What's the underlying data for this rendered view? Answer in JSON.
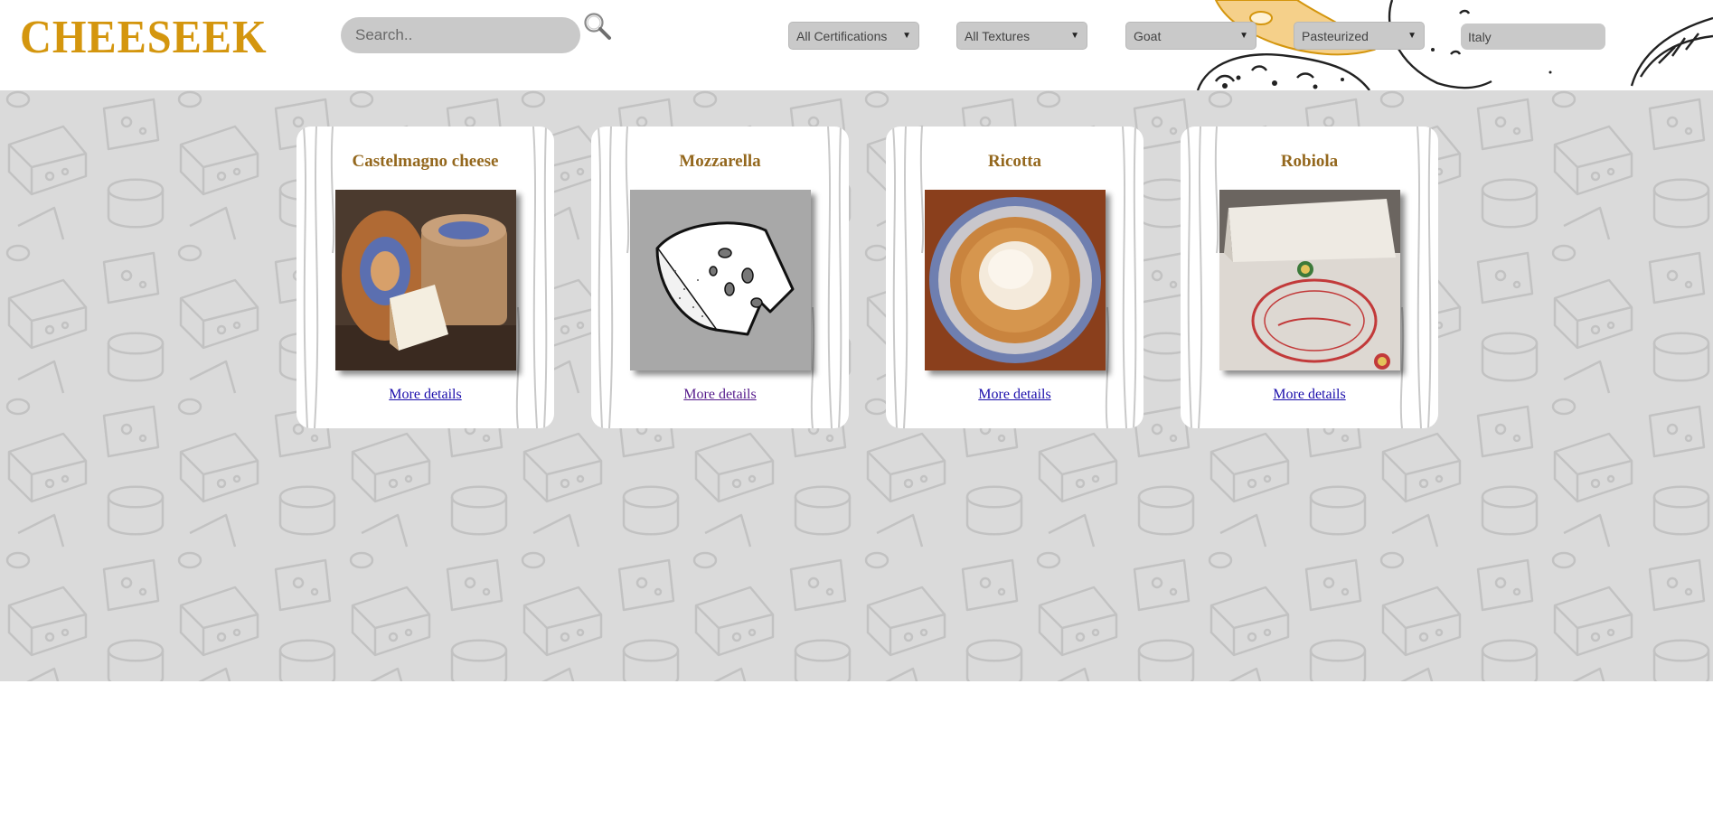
{
  "header": {
    "logo": "CHEESEEK",
    "search": {
      "placeholder": "Search..",
      "value": ""
    },
    "filters": {
      "certification": "All Certifications",
      "texture": "All Textures",
      "milk": "Goat",
      "treatment": "Pasteurized"
    },
    "country": {
      "value": "Italy"
    }
  },
  "cards": [
    {
      "title": "Castelmagno cheese",
      "link": "More details"
    },
    {
      "title": "Mozzarella",
      "link": "More details"
    },
    {
      "title": "Ricotta",
      "link": "More details"
    },
    {
      "title": "Robiola",
      "link": "More details"
    }
  ],
  "colors": {
    "logo": "#d4960e",
    "card_title": "#94681e",
    "link": "#1a0dab",
    "link_visited": "#551a8b",
    "background": "#dadada",
    "control": "#c9c9c9"
  },
  "icons": [
    "search-icon",
    "chevron-down-icon"
  ]
}
